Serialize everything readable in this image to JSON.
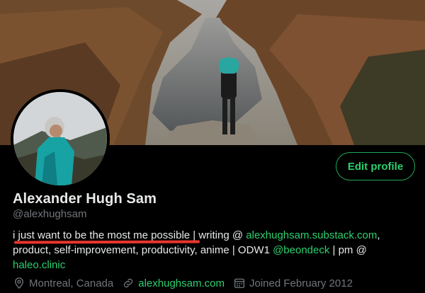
{
  "profile": {
    "name": "Alexander Hugh Sam",
    "handle": "@alexhughsam",
    "edit_label": "Edit profile",
    "bio": {
      "part1": "i just want to be the most me possible | writing @ ",
      "link1": "alexhughsam.substack.com",
      "part2": ", product, self-improvement, productivity, anime | ODW1 ",
      "link2": "@beondeck",
      "part3": " | pm @ ",
      "link3": "haleo.clinic"
    },
    "location": "Montreal, Canada",
    "website": "alexhughsam.com",
    "joined": "Joined February 2012"
  },
  "icons": {
    "location": "location-pin-icon",
    "website": "link-icon",
    "joined": "calendar-icon"
  },
  "colors": {
    "accent": "#2bd06e",
    "muted": "#71767b",
    "highlight_underline": "#e8362d",
    "background": "#000000"
  }
}
